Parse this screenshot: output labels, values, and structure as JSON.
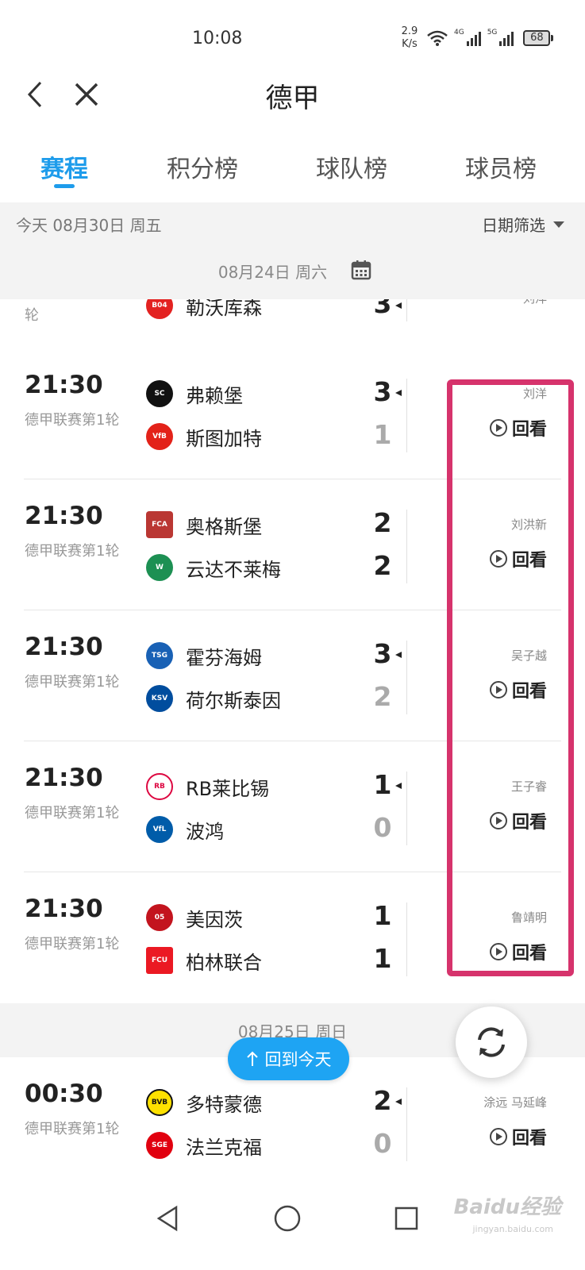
{
  "status_bar": {
    "time": "10:08",
    "speed_value": "2.9",
    "speed_unit": "K/s",
    "signal1_label": "4G",
    "signal2_label": "5G",
    "battery": "68"
  },
  "header": {
    "title": "德甲"
  },
  "tabs": [
    {
      "label": "赛程",
      "active": true
    },
    {
      "label": "积分榜",
      "active": false
    },
    {
      "label": "球队榜",
      "active": false
    },
    {
      "label": "球员榜",
      "active": false
    }
  ],
  "filter": {
    "today_label": "今天 08月30日 周五",
    "date_filter_label": "日期筛选"
  },
  "date_group_1": "08月24日 周六",
  "partial_match": {
    "round": "轮",
    "home_name": "勒沃库森",
    "home_score": "3",
    "commentator": "刘洋"
  },
  "matches": [
    {
      "time": "21:30",
      "round": "德甲联赛第1轮",
      "home": {
        "name": "弗赖堡",
        "score": "3",
        "logo_color": "#111111",
        "logo_text": "SC"
      },
      "away": {
        "name": "斯图加特",
        "score": "1",
        "logo_color": "#e32219",
        "logo_text": "VfB"
      },
      "commentator": "刘洋",
      "replay_label": "回看"
    },
    {
      "time": "21:30",
      "round": "德甲联赛第1轮",
      "home": {
        "name": "奥格斯堡",
        "score": "2",
        "logo_color": "#ba3733",
        "logo_text": "FCA"
      },
      "away": {
        "name": "云达不莱梅",
        "score": "2",
        "logo_color": "#1d9053",
        "logo_text": "W"
      },
      "commentator": "刘洪新",
      "replay_label": "回看"
    },
    {
      "time": "21:30",
      "round": "德甲联赛第1轮",
      "home": {
        "name": "霍芬海姆",
        "score": "3",
        "logo_color": "#1961b5",
        "logo_text": "TSG"
      },
      "away": {
        "name": "荷尔斯泰因",
        "score": "2",
        "logo_color": "#004d9e",
        "logo_text": "KSV"
      },
      "commentator": "吴子越",
      "replay_label": "回看"
    },
    {
      "time": "21:30",
      "round": "德甲联赛第1轮",
      "home": {
        "name": "RB莱比锡",
        "score": "1",
        "logo_color": "#dd0741",
        "logo_text": "RB"
      },
      "away": {
        "name": "波鸿",
        "score": "0",
        "logo_color": "#005ca9",
        "logo_text": "VfL"
      },
      "commentator": "王子睿",
      "replay_label": "回看"
    },
    {
      "time": "21:30",
      "round": "德甲联赛第1轮",
      "home": {
        "name": "美因茨",
        "score": "1",
        "logo_color": "#c3141e",
        "logo_text": "05"
      },
      "away": {
        "name": "柏林联合",
        "score": "1",
        "logo_color": "#eb1923",
        "logo_text": "FCU"
      },
      "commentator": "鲁靖明",
      "replay_label": "回看"
    }
  ],
  "date_group_2": "08月25日 周日",
  "match_last": {
    "time": "00:30",
    "round": "德甲联赛第1轮",
    "home": {
      "name": "多特蒙德",
      "score": "2",
      "logo_color": "#fde100",
      "logo_text": "BVB"
    },
    "away": {
      "name": "法兰克福",
      "score": "0",
      "logo_color": "#e1000f",
      "logo_text": "SGE"
    },
    "commentator": "涂远 马延峰",
    "replay_label": "回看"
  },
  "back_to_today": "回到今天",
  "watermark": "Baidu经验",
  "watermark_sub": "jingyan.baidu.com"
}
